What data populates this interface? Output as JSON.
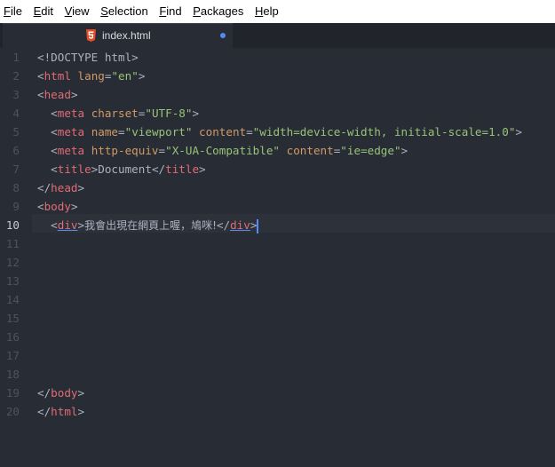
{
  "menubar": {
    "items": [
      {
        "mnemonic": "F",
        "rest": "ile"
      },
      {
        "mnemonic": "E",
        "rest": "dit"
      },
      {
        "mnemonic": "V",
        "rest": "iew"
      },
      {
        "mnemonic": "S",
        "rest": "election"
      },
      {
        "mnemonic": "F",
        "rest": "ind"
      },
      {
        "mnemonic": "P",
        "rest": "ackages"
      },
      {
        "mnemonic": "H",
        "rest": "elp"
      }
    ]
  },
  "tab": {
    "title": "index.html",
    "icon": "html5-icon",
    "modified": true
  },
  "editor": {
    "current_line": 10,
    "line_numbers": [
      "1",
      "2",
      "3",
      "4",
      "5",
      "6",
      "7",
      "8",
      "9",
      "10",
      "11",
      "12",
      "13",
      "14",
      "15",
      "16",
      "17",
      "18",
      "19",
      "20"
    ],
    "code": {
      "l1": "<!DOCTYPE html>",
      "l2_tag": "html",
      "l2_attr": "lang",
      "l2_val": "\"en\"",
      "l3_tag": "head",
      "l4_tag": "meta",
      "l4_attr": "charset",
      "l4_val": "\"UTF-8\"",
      "l5_tag": "meta",
      "l5_attr1": "name",
      "l5_val1": "\"viewport\"",
      "l5_attr2": "content",
      "l5_val2": "\"width=device-width, initial-scale=1.0\"",
      "l6_tag": "meta",
      "l6_attr1": "http-equiv",
      "l6_val1": "\"X-UA-Compatible\"",
      "l6_attr2": "content",
      "l6_val2": "\"ie=edge\"",
      "l7_tag": "title",
      "l7_text": "Document",
      "l7_close": "title",
      "l8_tag": "head",
      "l9_tag": "body",
      "l10_tag": "div",
      "l10_text": "我會出現在網頁上喔，鳩咪!",
      "l10_close": "div",
      "l19_tag": "body",
      "l20_tag": "html"
    }
  },
  "colors": {
    "background": "#282c34",
    "tag": "#e06c75",
    "attribute": "#d19a66",
    "string": "#98c379",
    "cursor": "#528bff"
  }
}
